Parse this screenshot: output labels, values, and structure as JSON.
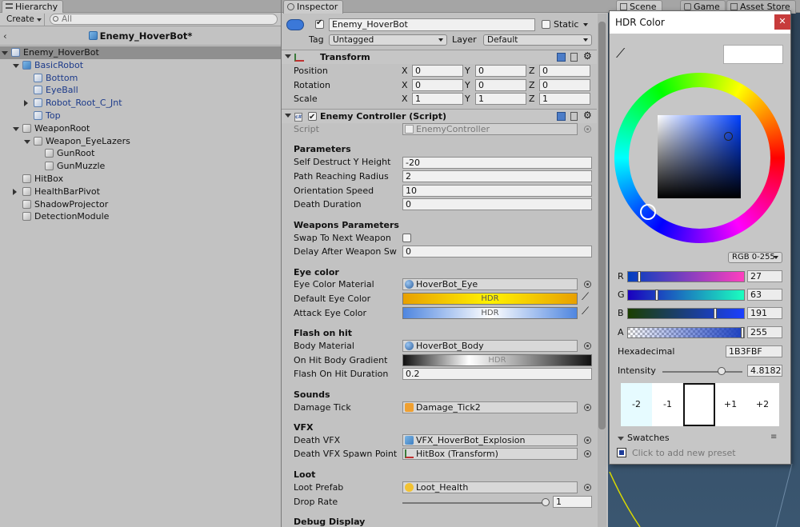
{
  "hierarchy": {
    "tab_label": "Hierarchy",
    "create_label": "Create",
    "search_placeholder": "All",
    "scene_name": "Enemy_HoverBot*",
    "items": [
      {
        "label": "Enemy_HoverBot",
        "depth": 0,
        "fold": "open",
        "selected": true,
        "color": "prefab"
      },
      {
        "label": "BasicRobot",
        "depth": 1,
        "fold": "open",
        "color": "blue"
      },
      {
        "label": "Bottom",
        "depth": 2,
        "fold": "none",
        "color": "blue"
      },
      {
        "label": "EyeBall",
        "depth": 2,
        "fold": "none",
        "color": "blue"
      },
      {
        "label": "Robot_Root_C_Jnt",
        "depth": 2,
        "fold": "closed",
        "color": "blue"
      },
      {
        "label": "Top",
        "depth": 2,
        "fold": "none",
        "color": "blue"
      },
      {
        "label": "WeaponRoot",
        "depth": 1,
        "fold": "open",
        "color": "normal"
      },
      {
        "label": "Weapon_EyeLazers",
        "depth": 2,
        "fold": "open",
        "color": "normal"
      },
      {
        "label": "GunRoot",
        "depth": 3,
        "fold": "none",
        "color": "normal"
      },
      {
        "label": "GunMuzzle",
        "depth": 3,
        "fold": "none",
        "color": "normal"
      },
      {
        "label": "HitBox",
        "depth": 1,
        "fold": "none",
        "color": "normal"
      },
      {
        "label": "HealthBarPivot",
        "depth": 1,
        "fold": "closed",
        "color": "normal"
      },
      {
        "label": "ShadowProjector",
        "depth": 1,
        "fold": "none",
        "color": "normal"
      },
      {
        "label": "DetectionModule",
        "depth": 1,
        "fold": "none",
        "color": "normal"
      }
    ]
  },
  "inspector": {
    "tab_label": "Inspector",
    "object_name": "Enemy_HoverBot",
    "static_label": "Static",
    "tag_label": "Tag",
    "tag_value": "Untagged",
    "layer_label": "Layer",
    "layer_value": "Default",
    "transform": {
      "title": "Transform",
      "rows": [
        {
          "label": "Position",
          "x": "0",
          "y": "0",
          "z": "0"
        },
        {
          "label": "Rotation",
          "x": "0",
          "y": "0",
          "z": "0"
        },
        {
          "label": "Scale",
          "x": "1",
          "y": "1",
          "z": "1"
        }
      ],
      "axis_x": "X",
      "axis_y": "Y",
      "axis_z": "Z"
    },
    "enemy_controller": {
      "title": "Enemy Controller (Script)",
      "script_label": "Script",
      "script_value": "EnemyController",
      "parameters_header": "Parameters",
      "self_destruct_label": "Self Destruct Y Height",
      "self_destruct_value": "-20",
      "path_radius_label": "Path Reaching Radius",
      "path_radius_value": "2",
      "orientation_label": "Orientation Speed",
      "orientation_value": "10",
      "death_duration_label": "Death Duration",
      "death_duration_value": "0",
      "weapons_header": "Weapons Parameters",
      "swap_label": "Swap To Next Weapon",
      "delay_label": "Delay After Weapon Sw",
      "delay_value": "0",
      "eye_header": "Eye color",
      "eye_material_label": "Eye Color Material",
      "eye_material_value": "HoverBot_Eye",
      "default_eye_label": "Default Eye Color",
      "attack_eye_label": "Attack Eye Color",
      "hdr_text": "HDR",
      "flash_header": "Flash on hit",
      "body_material_label": "Body Material",
      "body_material_value": "HoverBot_Body",
      "gradient_label": "On Hit Body Gradient",
      "flash_duration_label": "Flash On Hit Duration",
      "flash_duration_value": "0.2",
      "sounds_header": "Sounds",
      "damage_tick_label": "Damage Tick",
      "damage_tick_value": "Damage_Tick2",
      "vfx_header": "VFX",
      "death_vfx_label": "Death VFX",
      "death_vfx_value": "VFX_HoverBot_Explosion",
      "spawn_point_label": "Death VFX Spawn Point",
      "spawn_point_value": "HitBox (Transform)",
      "loot_header": "Loot",
      "loot_prefab_label": "Loot Prefab",
      "loot_prefab_value": "Loot_Health",
      "drop_rate_label": "Drop Rate",
      "drop_rate_value": "1",
      "debug_header": "Debug Display"
    }
  },
  "scene_tabs": {
    "scene": "Scene",
    "game": "Game",
    "asset_store": "Asset Store"
  },
  "hdr_dialog": {
    "title": "HDR Color",
    "mode": "RGB 0-255",
    "r_label": "R",
    "r_value": "27",
    "g_label": "G",
    "g_value": "63",
    "b_label": "B",
    "b_value": "191",
    "a_label": "A",
    "a_value": "255",
    "hex_label": "Hexadecimal",
    "hex_value": "1B3FBF",
    "intensity_label": "Intensity",
    "intensity_value": "4.8182",
    "stops": [
      "-2",
      "-1",
      "+1",
      "+2"
    ],
    "swatches_label": "Swatches",
    "add_preset_text": "Click to add new preset",
    "colors": {
      "current": "#1b3fbf",
      "swatch_bg": "#1e3d99"
    }
  }
}
